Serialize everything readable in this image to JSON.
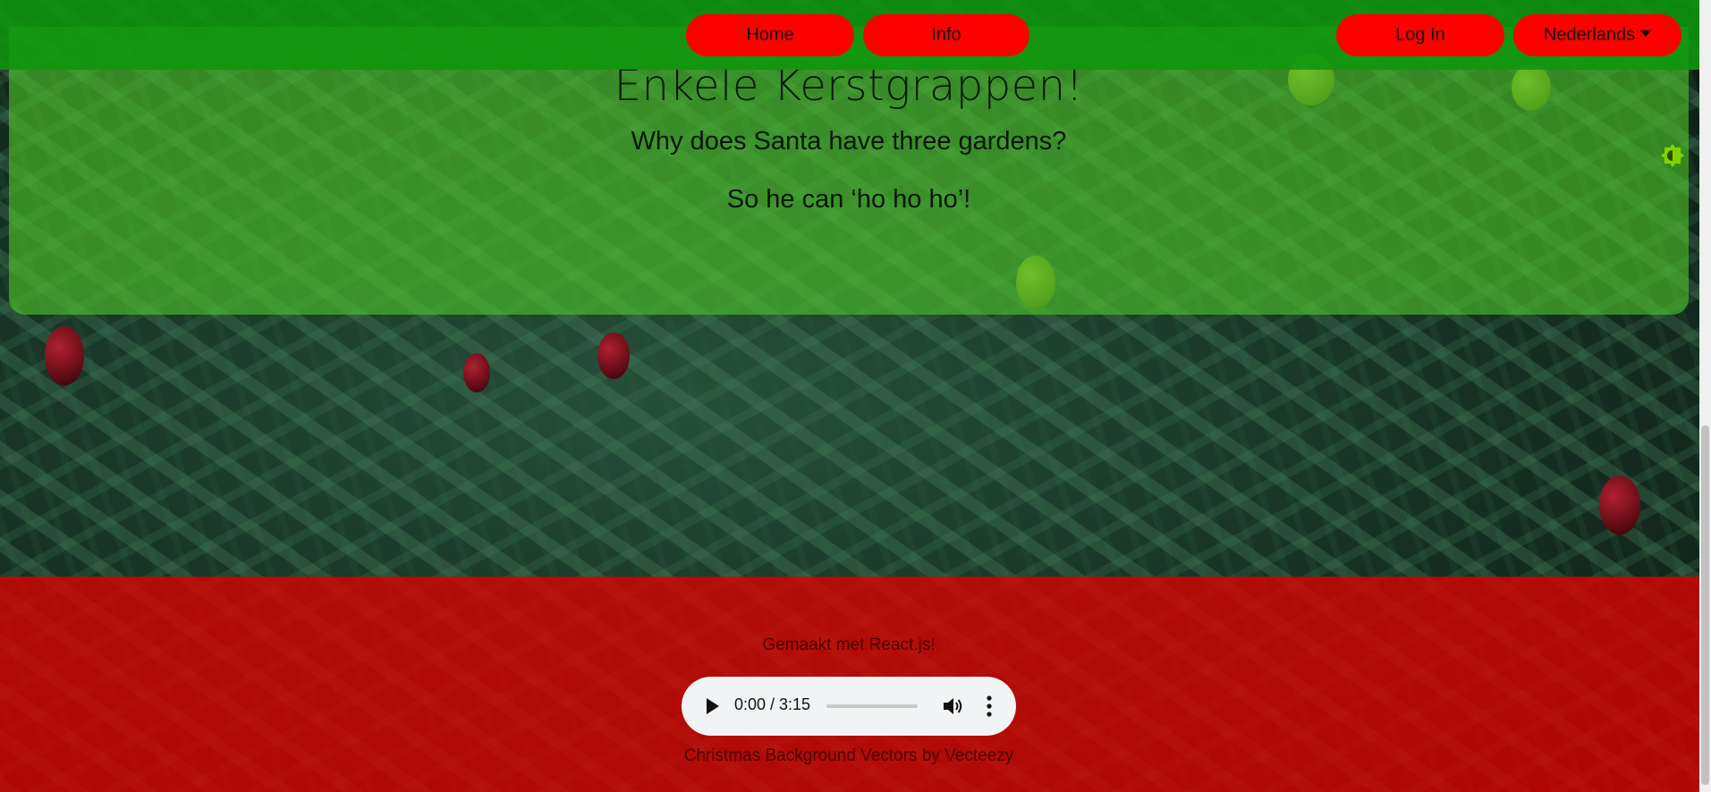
{
  "nav": {
    "home_label": "Home",
    "info_label": "Info",
    "login_label": "Log In",
    "language_label": "Nederlands"
  },
  "main": {
    "heading": "Enkele Kerstgrappen!",
    "joke_question": "Why does Santa have three gardens?",
    "joke_answer": "So he can ‘ho ho ho’!"
  },
  "theme_toggle": {
    "icon": "brightness-icon",
    "color": "#7fd400"
  },
  "footer": {
    "made_with": "Gemaakt met React.js!",
    "credit": "Christmas Background Vectors by Vecteezy"
  },
  "audio": {
    "time": "0:00 / 3:15",
    "progress_fraction": 0
  },
  "colors": {
    "nav_bar": "#0e960e",
    "nav_button": "#ff0000",
    "card": "#50c828",
    "footer": "#dc0000"
  }
}
